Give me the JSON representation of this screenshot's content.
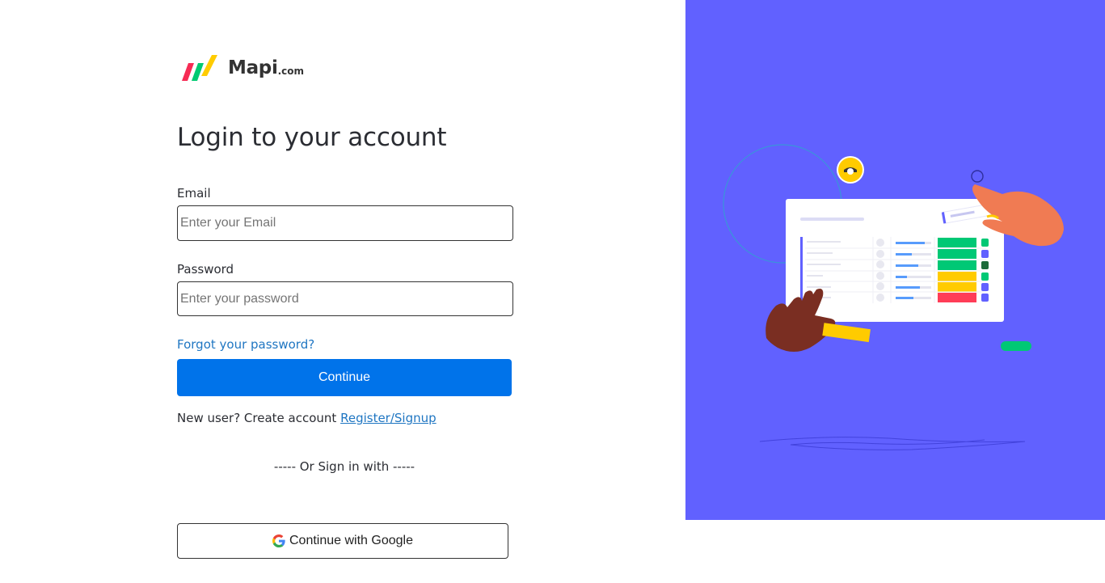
{
  "brand": {
    "name": "Mapi",
    "tld": ".com",
    "logo_colors": [
      "#f62b54",
      "#00ca72",
      "#ffcc00"
    ]
  },
  "page_title": "Login to your account",
  "form": {
    "email_label": "Email",
    "email_placeholder": "Enter your Email",
    "email_value": "",
    "password_label": "Password",
    "password_placeholder": "Enter your password",
    "password_value": "",
    "forgot_link": "Forgot your password?",
    "continue_label": "Continue"
  },
  "signup": {
    "prompt": "New user? Create account",
    "link": "Register/Signup"
  },
  "divider_text": "----- Or Sign in with -----",
  "google_button": {
    "label": "Continue with Google",
    "icon": "google-icon"
  },
  "illustration": {
    "background_color": "#6161ff",
    "description_icon": "dashboard-illustration",
    "status_colors": [
      "#00c875",
      "#00c875",
      "#00c875",
      "#ffcb00",
      "#ffcb00",
      "#ff3d57"
    ]
  },
  "colors": {
    "accent": "#0073ea",
    "link": "#1f76c2"
  }
}
